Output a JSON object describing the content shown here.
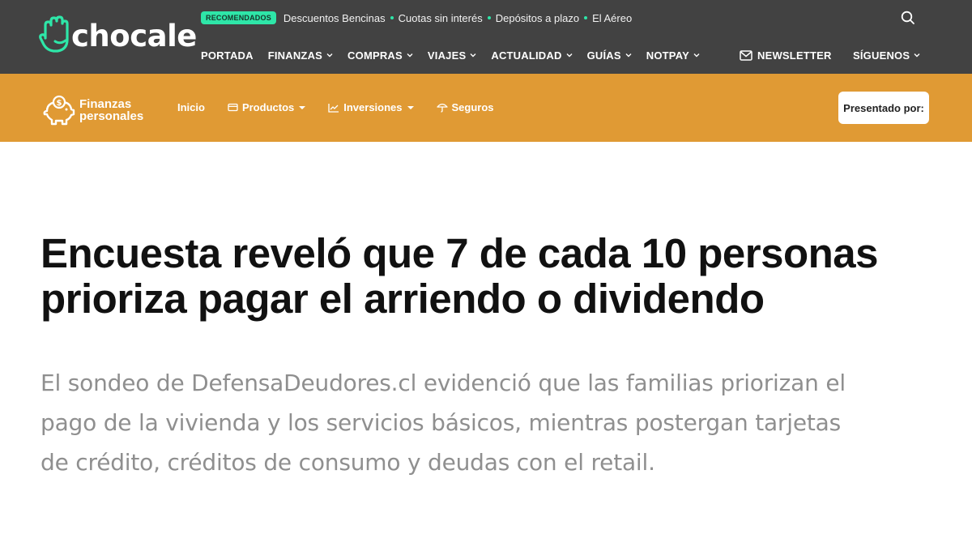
{
  "brand": {
    "name": "chocale"
  },
  "recommended": {
    "badge": "RECOMENDADOS",
    "links": [
      "Descuentos Bencinas",
      "Cuotas sin interés",
      "Depósitos a plazo",
      "El Aéreo"
    ]
  },
  "main_nav": {
    "items": [
      {
        "label": "PORTADA"
      },
      {
        "label": "FINANZAS"
      },
      {
        "label": "COMPRAS"
      },
      {
        "label": "VIAJES"
      },
      {
        "label": "ACTUALIDAD"
      },
      {
        "label": "GUÍAS"
      },
      {
        "label": "NOTPAY"
      }
    ],
    "newsletter": "NEWSLETTER",
    "follow": "SÍGUENOS"
  },
  "section": {
    "logo_line1": "Finanzas",
    "logo_line2": "personales",
    "items": [
      {
        "label": "Inicio"
      },
      {
        "label": "Productos"
      },
      {
        "label": "Inversiones"
      },
      {
        "label": "Seguros"
      }
    ],
    "sponsor": "Presentado por:"
  },
  "article": {
    "headline_line1": "Encuesta reveló que 7 de cada 10 personas",
    "headline_line2": "prioriza pagar el arriendo o dividendo",
    "lead_line1": "El sondeo de DefensaDeudores.cl evidenció que las familias priorizan el",
    "lead_line2": "pago de la vivienda y los servicios básicos, mientras postergan tarjetas",
    "lead_line3": "de crédito, créditos de consumo y deudas con el retail."
  },
  "colors": {
    "topbar": "#424242",
    "accent_green": "#2ee6a8",
    "section_orange": "#e09a34"
  }
}
